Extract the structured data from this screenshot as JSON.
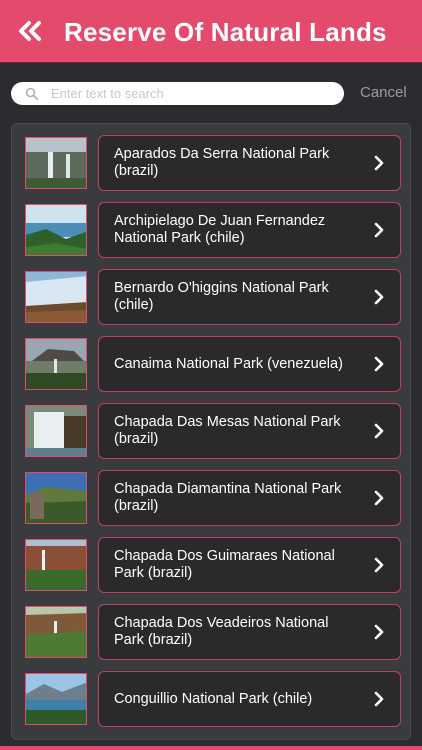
{
  "header": {
    "title": "Reserve Of Natural Lands",
    "back_icon": "double-chevron-left-icon"
  },
  "search": {
    "placeholder": "Enter text to search",
    "value": "",
    "cancel_label": "Cancel"
  },
  "colors": {
    "accent": "#e34a6b",
    "background": "#2b2c2f",
    "card": "#2a2a2c"
  },
  "parks": [
    {
      "label": "Aparados Da Serra National Park (brazil)"
    },
    {
      "label": "Archipielago De Juan Fernandez National Park (chile)"
    },
    {
      "label": "Bernardo O'higgins National Park (chile)"
    },
    {
      "label": "Canaima National Park (venezuela)"
    },
    {
      "label": "Chapada Das Mesas National Park (brazil)"
    },
    {
      "label": "Chapada Diamantina National Park (brazil)"
    },
    {
      "label": "Chapada Dos Guimaraes National Park (brazil)"
    },
    {
      "label": "Chapada Dos Veadeiros National Park (brazil)"
    },
    {
      "label": "Conguillio National Park (chile)"
    }
  ]
}
